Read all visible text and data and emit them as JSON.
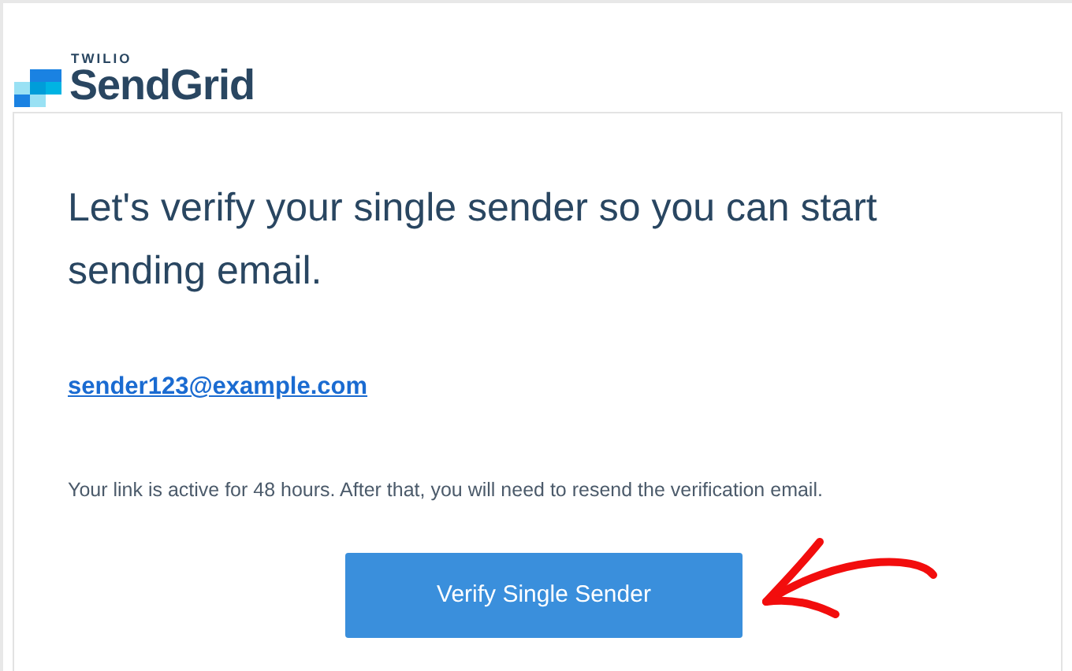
{
  "logo": {
    "overline": "TWILIO",
    "wordmark": "SendGrid"
  },
  "heading": "Let's verify your single sender so you can start sending email.",
  "email_link": "sender123@example.com",
  "note": "Your link is active for 48 hours. After that, you will need to resend the verification email.",
  "button": "Verify Single Sender"
}
